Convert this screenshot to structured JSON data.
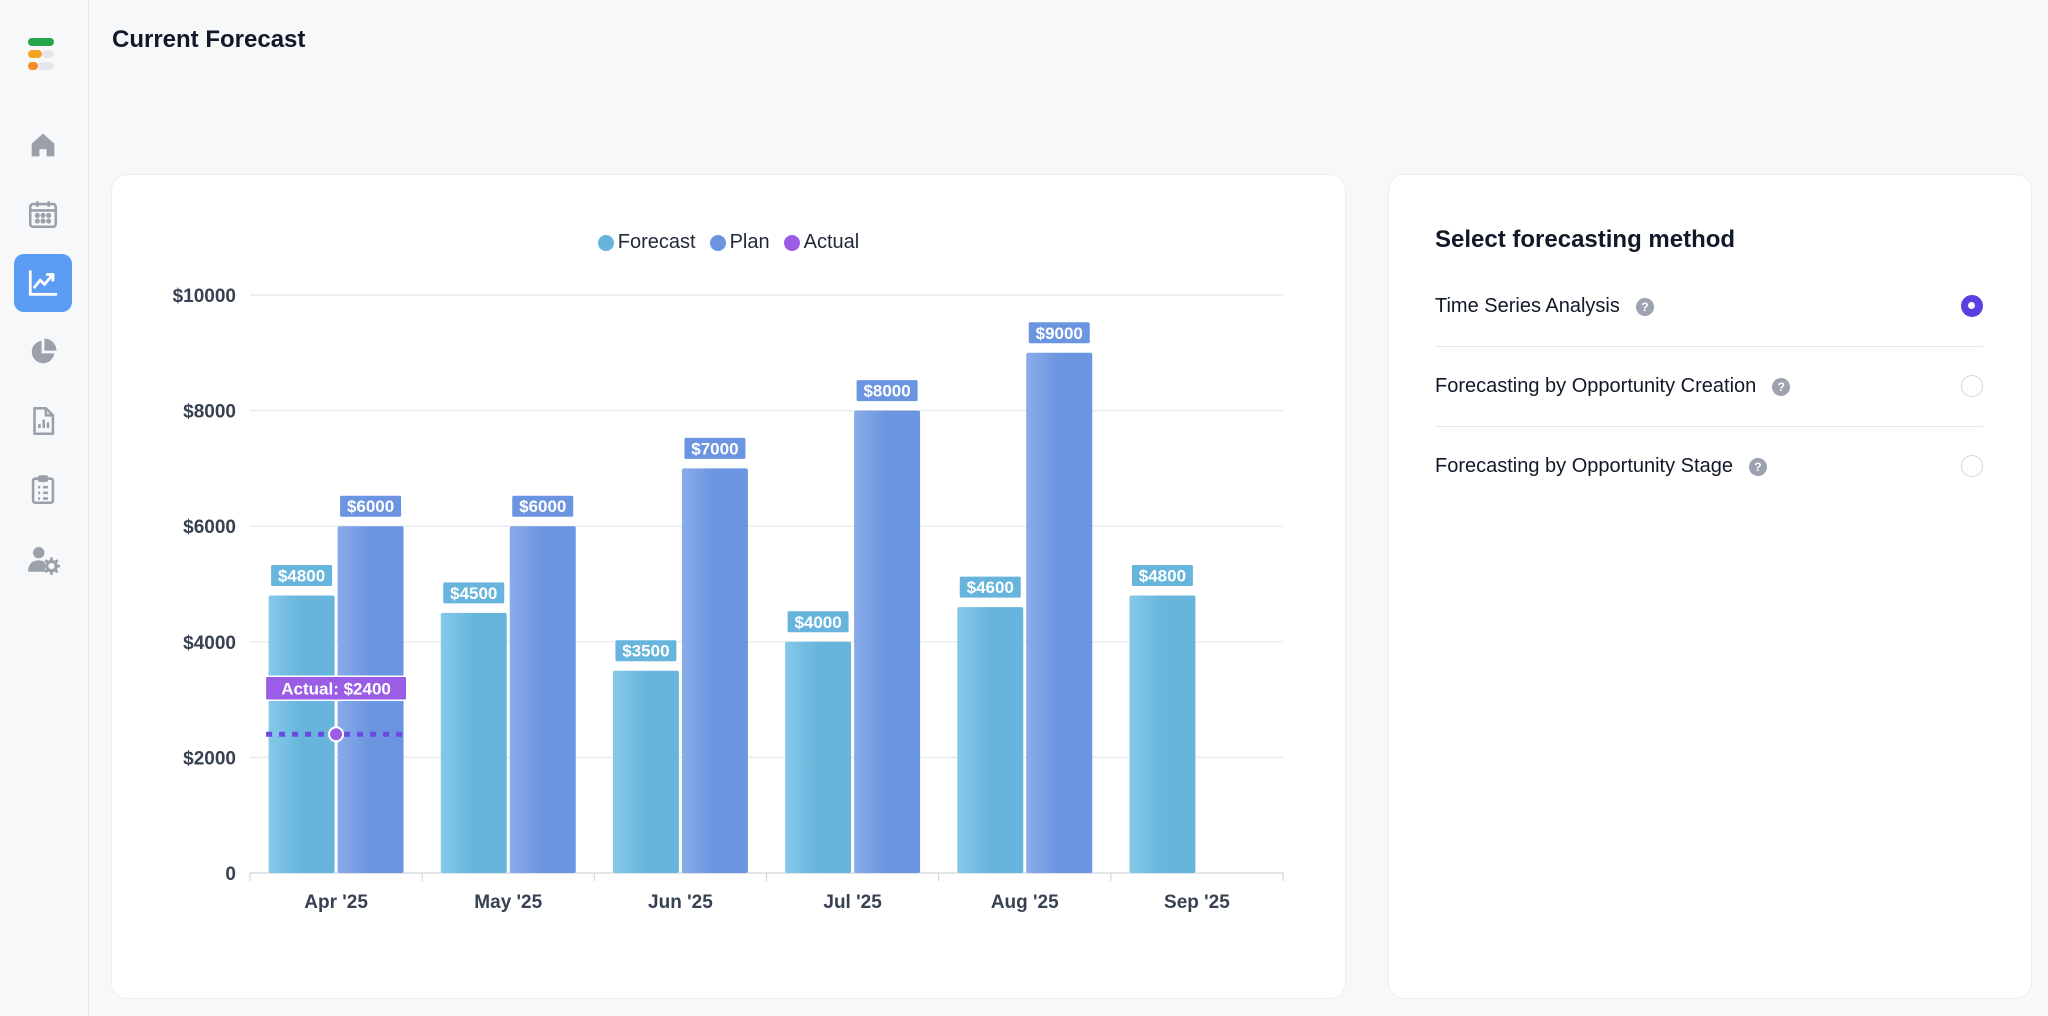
{
  "page": {
    "title": "Current Forecast"
  },
  "sidebar": {
    "items": [
      {
        "name": "home-icon",
        "active": false
      },
      {
        "name": "calendar-icon",
        "active": false
      },
      {
        "name": "trend-chart-icon",
        "active": true
      },
      {
        "name": "pie-chart-icon",
        "active": false
      },
      {
        "name": "report-icon",
        "active": false
      },
      {
        "name": "clipboard-icon",
        "active": false
      },
      {
        "name": "user-settings-icon",
        "active": false
      }
    ]
  },
  "chart_data": {
    "type": "bar",
    "categories": [
      "Apr '25",
      "May '25",
      "Jun '25",
      "Jul '25",
      "Aug '25",
      "Sep '25"
    ],
    "series": [
      {
        "name": "Forecast",
        "values": [
          4800,
          4500,
          3500,
          4000,
          4600,
          4800
        ],
        "color": "#67b5dd"
      },
      {
        "name": "Plan",
        "values": [
          6000,
          6000,
          7000,
          8000,
          9000,
          null
        ],
        "color": "#6b95e0"
      }
    ],
    "actual": {
      "name": "Actual",
      "category": "Apr '25",
      "value": 2400,
      "label": "Actual: $2400",
      "color": "#9b5de5"
    },
    "legend": [
      "Forecast",
      "Plan",
      "Actual"
    ],
    "legend_position": "top-center",
    "y_ticks": [
      0,
      2000,
      4000,
      6000,
      8000,
      10000
    ],
    "y_tick_labels": [
      "0",
      "$2000",
      "$4000",
      "$6000",
      "$8000",
      "$10000"
    ],
    "ylim": [
      0,
      10000
    ],
    "grid": true,
    "value_prefix": "$"
  },
  "method": {
    "title": "Select forecasting method",
    "options": [
      {
        "label": "Time Series Analysis",
        "selected": true
      },
      {
        "label": "Forecasting by Opportunity Creation",
        "selected": false
      },
      {
        "label": "Forecasting by Opportunity Stage",
        "selected": false
      }
    ],
    "help_glyph": "?"
  },
  "colors": {
    "accent": "#5b3fe0",
    "nav_active": "#5b9cf5"
  }
}
